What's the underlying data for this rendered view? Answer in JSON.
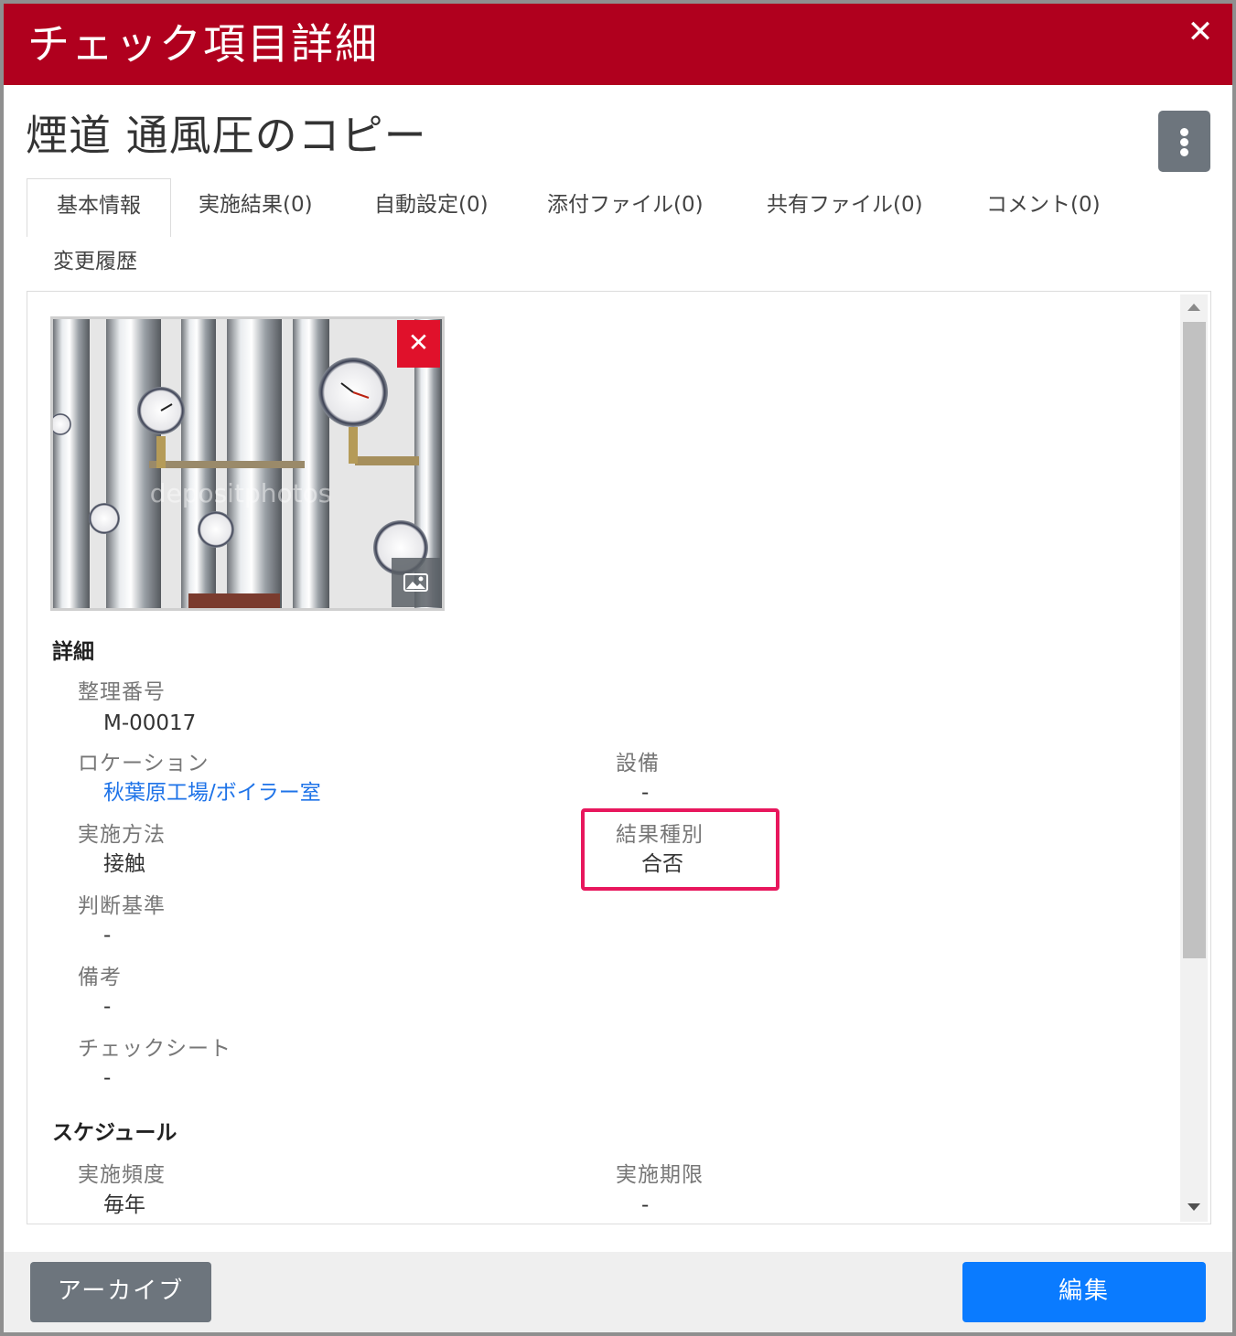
{
  "dialog": {
    "title": "チェック項目詳細",
    "close_icon": "close-icon"
  },
  "item": {
    "name": "煙道 通風圧のコピー",
    "menu_icon": "kebab-menu-icon"
  },
  "tabs": [
    {
      "label": "基本情報",
      "active": true
    },
    {
      "label": "実施結果(0)",
      "active": false
    },
    {
      "label": "自動設定(0)",
      "active": false
    },
    {
      "label": "添付ファイル(0)",
      "active": false
    },
    {
      "label": "共有ファイル(0)",
      "active": false
    },
    {
      "label": "コメント(0)",
      "active": false
    },
    {
      "label": "変更履歴",
      "active": false
    }
  ],
  "photo": {
    "watermark": "depositphotos",
    "delete_icon": "close-icon",
    "view_icon": "image-icon"
  },
  "details": {
    "section_title": "詳細",
    "control_number": {
      "label": "整理番号",
      "value": "M-00017"
    },
    "location": {
      "label": "ロケーション",
      "value": "秋葉原工場/ボイラー室"
    },
    "equipment": {
      "label": "設備",
      "value": "-"
    },
    "method": {
      "label": "実施方法",
      "value": "接触"
    },
    "result_type": {
      "label": "結果種別",
      "value": "合否"
    },
    "criteria": {
      "label": "判断基準",
      "value": "-"
    },
    "notes": {
      "label": "備考",
      "value": "-"
    },
    "check_sheet": {
      "label": "チェックシート",
      "value": "-"
    }
  },
  "schedule": {
    "section_title": "スケジュール",
    "frequency": {
      "label": "実施頻度",
      "value": "毎年"
    },
    "deadline": {
      "label": "実施期限",
      "value": "-"
    }
  },
  "footer": {
    "archive_label": "アーカイブ",
    "edit_label": "編集"
  },
  "colors": {
    "header": "#b0001e",
    "primary": "#0a7bff",
    "secondary": "#6d757d",
    "danger": "#e0112b",
    "link": "#1e73e8",
    "highlight": "#e8175d"
  }
}
